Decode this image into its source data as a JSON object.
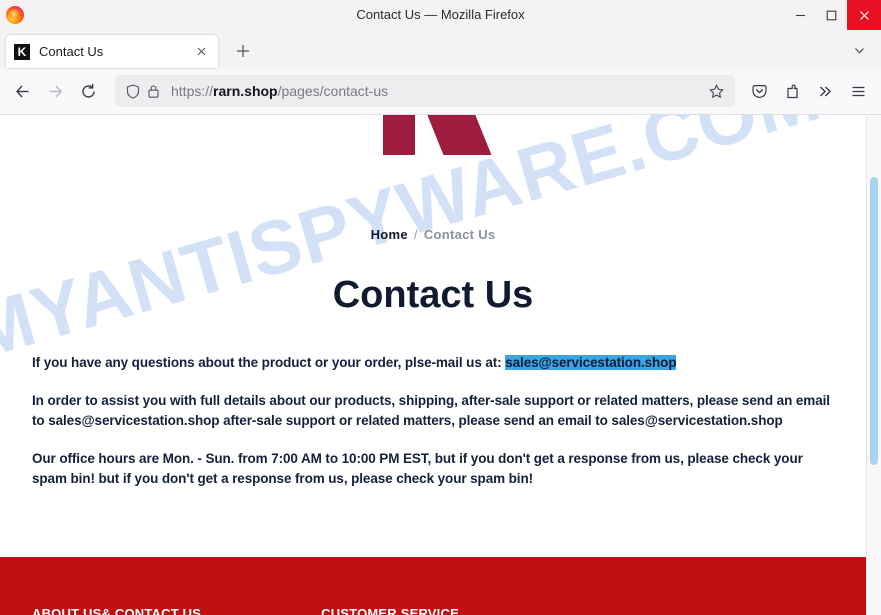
{
  "window": {
    "title": "Contact Us — Mozilla Firefox",
    "minimize_label": "Minimize",
    "maximize_label": "Maximize",
    "close_label": "Close"
  },
  "tabs": {
    "items": [
      {
        "favicon_letter": "K",
        "title": "Contact Us",
        "close_label": "×"
      }
    ],
    "new_tab_label": "+",
    "list_all_tabs_label": "v"
  },
  "navbar": {
    "back_label": "Back",
    "forward_label": "Forward",
    "reload_label": "Reload",
    "url_scheme": "https://",
    "url_host": "rarn.shop",
    "url_path": "/pages/contact-us",
    "url_full": "https://rarn.shop/pages/contact-us",
    "bookmark_label": "Bookmark this page",
    "pocket_label": "Save to Pocket",
    "extension_label": "Extensions",
    "overflow_label": "More tools",
    "menu_label": "Open application menu"
  },
  "page": {
    "watermark": "MYANTISPYWARE.COM",
    "breadcrumb": {
      "home": "Home",
      "separator": "/",
      "current": "Contact Us"
    },
    "title": "Contact Us",
    "paragraph_1_pre": "If you have any questions about the product or your order, plse-mail us at: ",
    "paragraph_1_email": "sales@servicestation.shop",
    "paragraph_2": "In order to assist you with full details about our products, shipping, after-sale support or related matters, please send an email to sales@servicestation.shop after-sale support or related matters, please send an email to sales@servicestation.shop",
    "paragraph_3": "Our office hours are Mon. - Sun. from 7:00 AM to 10:00 PM EST, but if you don't get a response from us, please check your spam bin! but if you don't get a response from us, please check your spam bin!",
    "footer": {
      "column_1_heading": "ABOUT US& CONTACT US",
      "column_2_heading": "CUSTOMER SERVICE"
    },
    "colors": {
      "footer_red": "#bd1010",
      "logo_maroon": "#9e1c3f",
      "heading_navy": "#111a2e",
      "selection_blue": "#3aa5e0",
      "watermark_blue": "#c3d6f5",
      "scrollbar_thumb": "#a8d4ec"
    }
  }
}
